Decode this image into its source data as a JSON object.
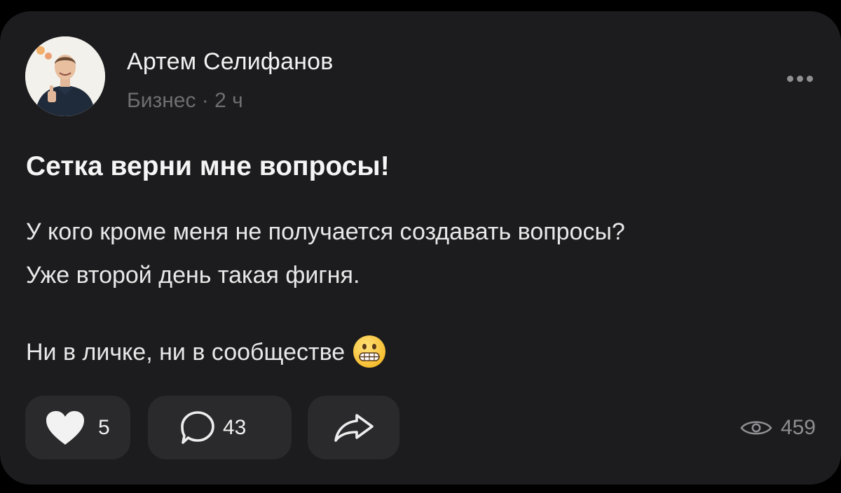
{
  "post": {
    "author": {
      "name": "Артем Селифанов",
      "category": "Бизнес",
      "separator": "·",
      "time": "2 ч",
      "avatar": "profile-photo"
    },
    "title": "Сетка верни мне вопросы!",
    "body": {
      "line1": "У кого кроме меня не получается создавать вопросы?",
      "line2": "Уже второй день такая фигня.",
      "line3": "Ни в личке, ни в сообществе"
    },
    "emoji": "grimacing-face",
    "actions": {
      "likes": "5",
      "comments": "43",
      "share_icon": "share-arrow-icon"
    },
    "views": "459"
  },
  "colors": {
    "background": "#000000",
    "card": "#1c1c1e",
    "pill": "#2a2a2c",
    "primary_text": "#f2f2f2",
    "secondary_text": "#6e6e73",
    "icon": "#8e8e93"
  }
}
